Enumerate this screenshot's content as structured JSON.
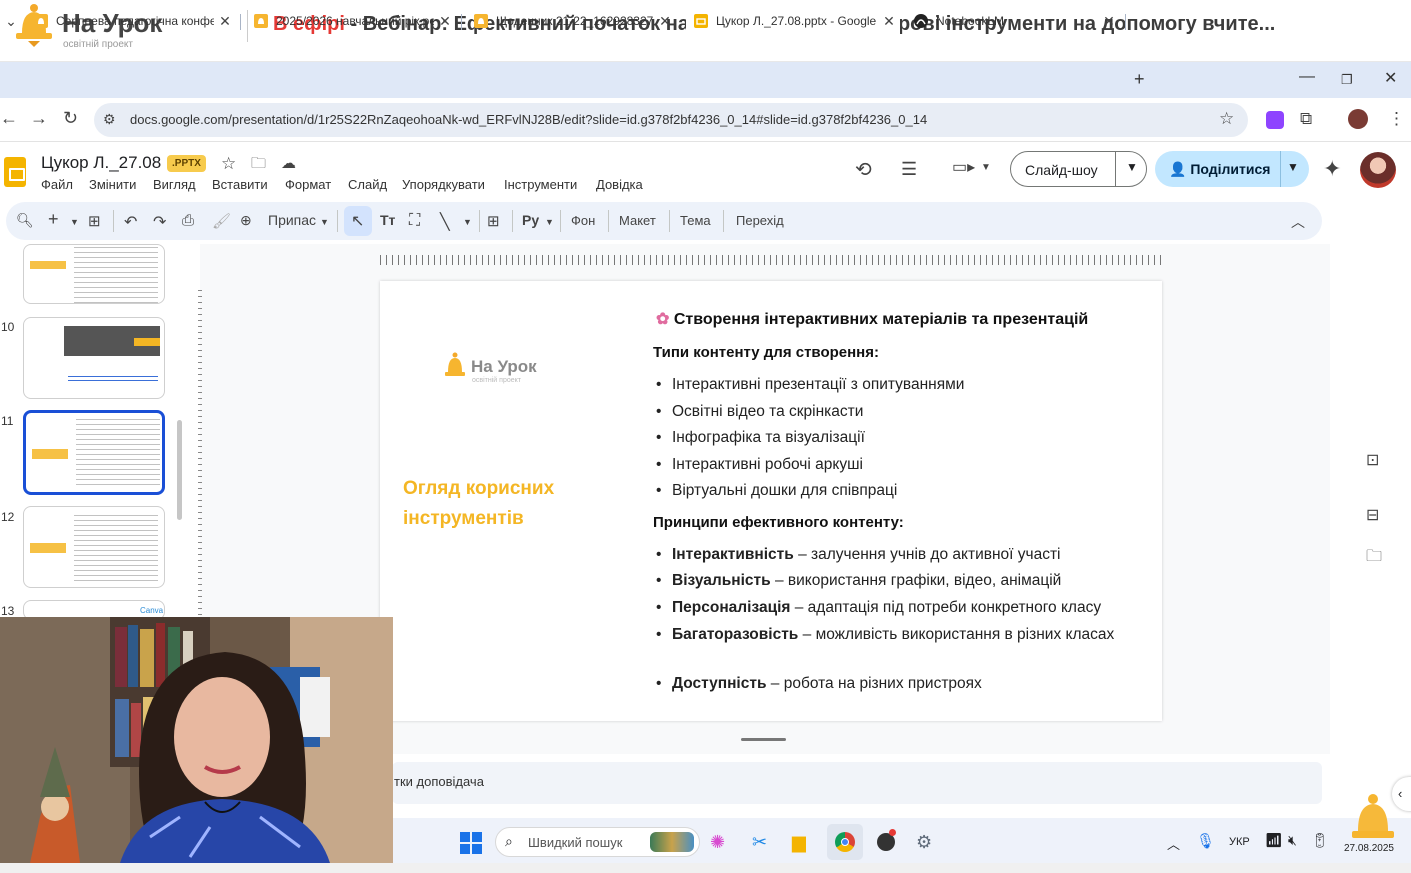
{
  "stream": {
    "logo_name": "На Урок",
    "logo_sub": "освітній проект",
    "live_label": "В ефірі",
    "title": " - Вебінар: Ефективний початок навчального року: цифрові інструменти на допомогу вчите..."
  },
  "browser": {
    "tabs": [
      {
        "label": "Серпнева педагогічна конфер",
        "icon": "naurok-icon",
        "active": false
      },
      {
        "label": "2025/2026 навчальний рік ре",
        "icon": "naurok-icon",
        "active": false
      },
      {
        "label": "Щоденник 21-22_1629283274",
        "icon": "naurok-icon",
        "active": false
      },
      {
        "label": "Цукор Л._27.08.pptx - Google",
        "icon": "google-slides-icon",
        "active": true
      },
      {
        "label": "NotebookLM",
        "icon": "notebooklm-icon",
        "active": false
      }
    ],
    "new_tab": "+",
    "url": "docs.google.com/presentation/d/1r25S22RnZaqeohoaNk-wd_ERFvlNJ28B/edit?slide=id.g378f2bf4236_0_14#slide=id.g378f2bf4236_0_14"
  },
  "doc": {
    "title": "Цукор Л._27.08",
    "badge": ".PPTX",
    "menu": [
      "Файл",
      "Змінити",
      "Вигляд",
      "Вставити",
      "Формат",
      "Слайд",
      "Упорядкувати",
      "Інструменти",
      "Довідка"
    ],
    "slideshow_label": "Слайд-шоу",
    "share_label": "Поділитися"
  },
  "toolbar": {
    "zoom_label": "Припас",
    "background": "Фон",
    "layout": "Макет",
    "theme": "Тема",
    "transition": "Перехід"
  },
  "thumbnails": {
    "numbers": [
      "10",
      "11",
      "12",
      "13"
    ],
    "selected": "11"
  },
  "slide": {
    "logo_name": "На Урок",
    "logo_sub": "освітній проект",
    "subtitle_line1": "Огляд корисних",
    "subtitle_line2": "інструментів",
    "heading": "Створення інтерактивних матеріалів та презентацій",
    "section1_title": "Типи контенту для створення:",
    "section1_items": [
      "Інтерактивні презентації з опитуваннями",
      "Освітні відео та скрінкасти",
      "Інфографіка та візуалізації",
      "Інтерактивні робочі аркуші",
      "Віртуальні дошки для співпраці"
    ],
    "section2_title": "Принципи ефективного контенту:",
    "section2_items": [
      {
        "term": "Інтерактивність",
        "text": " – залучення учнів до активної участі"
      },
      {
        "term": "Візуальність",
        "text": " – використання графіки, відео, анімацій"
      },
      {
        "term": "Персоналізація",
        "text": " – адаптація під потреби конкретного класу"
      },
      {
        "term": "Багаторазовість",
        "text": " – можливість використання в різних класах"
      },
      {
        "term": "Доступність",
        "text": " – робота на різних пристроях"
      }
    ]
  },
  "notes_text": "тки доповідача",
  "taskbar": {
    "search_placeholder": "Швидкий пошук",
    "lang": "УКР",
    "time": "18:29",
    "date": "27.08.2025"
  },
  "colors": {
    "accent_blue": "#1a4fd6",
    "slide_yellow": "#f4b624",
    "live_red": "#e53935"
  }
}
